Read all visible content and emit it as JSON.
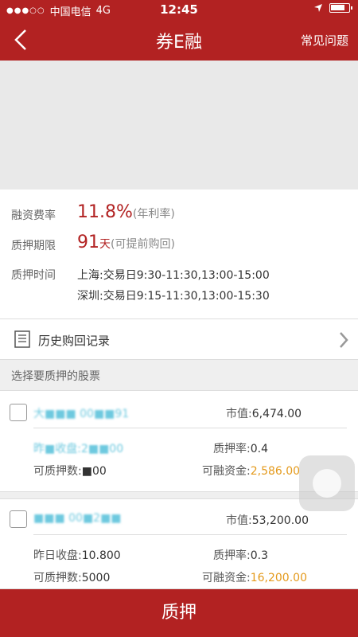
{
  "status_bar": {
    "signal": "●●●○○",
    "carrier": "中国电信",
    "network": "4G",
    "time": "12:45",
    "battery_level": 0.8
  },
  "navbar": {
    "title": "券E融",
    "right_link": "常见问题",
    "back_icon": "chevron-left-icon"
  },
  "info": {
    "rate_label": "融资费率",
    "rate_value": "11.8%",
    "rate_note": "(年利率)",
    "term_label": "质押期限",
    "term_value": "91",
    "term_unit": "天",
    "term_note": "(可提前购回)",
    "time_label": "质押时间",
    "time_sh": "上海:交易日9:30-11:30,13:00-15:00",
    "time_sz": "深圳:交易日9:15-11:30,13:00-15:30"
  },
  "history": {
    "label": "历史购回记录"
  },
  "section_head": "选择要质押的股票",
  "stocks": [
    {
      "name": "大■■■ 00■■91",
      "market_value_label": "市值:",
      "market_value": "6,474.00",
      "close_label": "昨■收盘:2■■00",
      "close_value": "",
      "rate_label": "质押率:",
      "rate_value": "0.4",
      "pledgeable_label": "可质押数:",
      "pledgeable_value": "■00",
      "financing_label": "可融资金:",
      "financing_value": "2,586.00"
    },
    {
      "name": "■■■ 00■2■■",
      "market_value_label": "市值:",
      "market_value": "53,200.00",
      "close_label": "昨日收盘:",
      "close_value": "10.800",
      "rate_label": "质押率:",
      "rate_value": "0.3",
      "pledgeable_label": "可质押数:",
      "pledgeable_value": "5000",
      "financing_label": "可融资金:",
      "financing_value": "16,200.00"
    }
  ],
  "bottom_button": "质押",
  "colors": {
    "brand_red": "#b22222",
    "amount_orange": "#e49a1c"
  }
}
